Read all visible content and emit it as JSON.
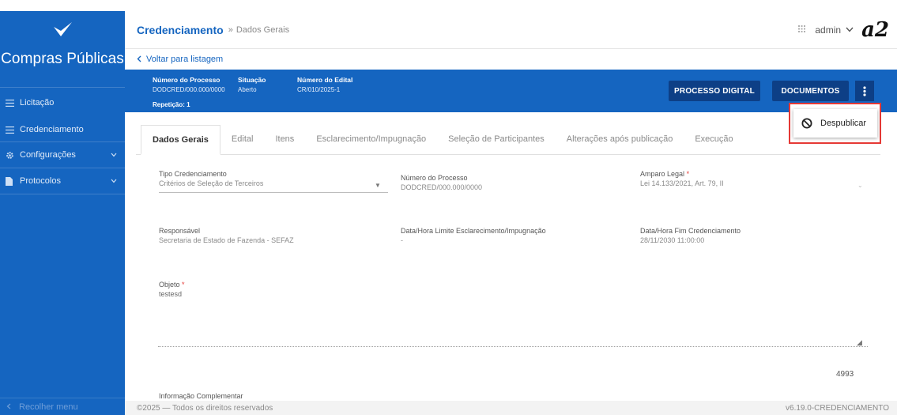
{
  "sidebar": {
    "app_title": "Compras Públicas",
    "items": [
      {
        "label": "Licitação",
        "icon": "list-icon"
      },
      {
        "label": "Credenciamento",
        "icon": "list-icon"
      },
      {
        "label": "Configurações",
        "icon": "gear-icon",
        "has_chevron": true
      },
      {
        "label": "Protocolos",
        "icon": "file-icon",
        "has_chevron": true
      }
    ],
    "collapse_label": "Recolher menu"
  },
  "header": {
    "title": "Credenciamento",
    "separator": "»",
    "subtitle": "Dados Gerais",
    "user": "admin",
    "logo": "a2"
  },
  "back_link": "Voltar para listagem",
  "process": {
    "numero_label": "Número do Processo",
    "numero_value": "DODCRED/000.000/0000",
    "situacao_label": "Situação",
    "situacao_value": "Aberto",
    "edital_label": "Número do Edital",
    "edital_value": "CR/010/2025-1",
    "repeticao": "Repetição: 1",
    "btn_processo_digital": "PROCESSO DIGITAL",
    "btn_documentos": "DOCUMENTOS"
  },
  "menu": {
    "items": [
      {
        "label": "Despublicar",
        "icon": "block-icon"
      }
    ]
  },
  "tabs": [
    "Dados Gerais",
    "Edital",
    "Itens",
    "Esclarecimento/Impugnação",
    "Seleção de Participantes",
    "Alterações após publicação",
    "Execução"
  ],
  "form": {
    "tipo_label": "Tipo Credenciamento",
    "tipo_value": "Critérios de Seleção de Terceiros",
    "numero_label": "Número do Processo",
    "numero_value": "DODCRED/000.000/0000",
    "amparo_label": "Amparo Legal",
    "amparo_value": "Lei 14.133/2021, Art. 79, II",
    "responsavel_label": "Responsável",
    "responsavel_value": "Secretaria de Estado de Fazenda - SEFAZ",
    "limite_label": "Data/Hora Limite Esclarecimento/Impugnação",
    "limite_value": "-",
    "fim_label": "Data/Hora Fim Credenciamento",
    "fim_value": "28/11/2030 11:00:00",
    "objeto_label": "Objeto",
    "objeto_value": "testesd",
    "counter": "4993",
    "info_label": "Informação Complementar",
    "required_mark": "*"
  },
  "footer": {
    "copyright": "©2025 — Todos os direitos reservados",
    "version": "v6.19.0-CREDENCIAMENTO"
  },
  "colors": {
    "primary": "#1565c0",
    "dark_button": "#0d3f86",
    "highlight": "#e53935"
  }
}
